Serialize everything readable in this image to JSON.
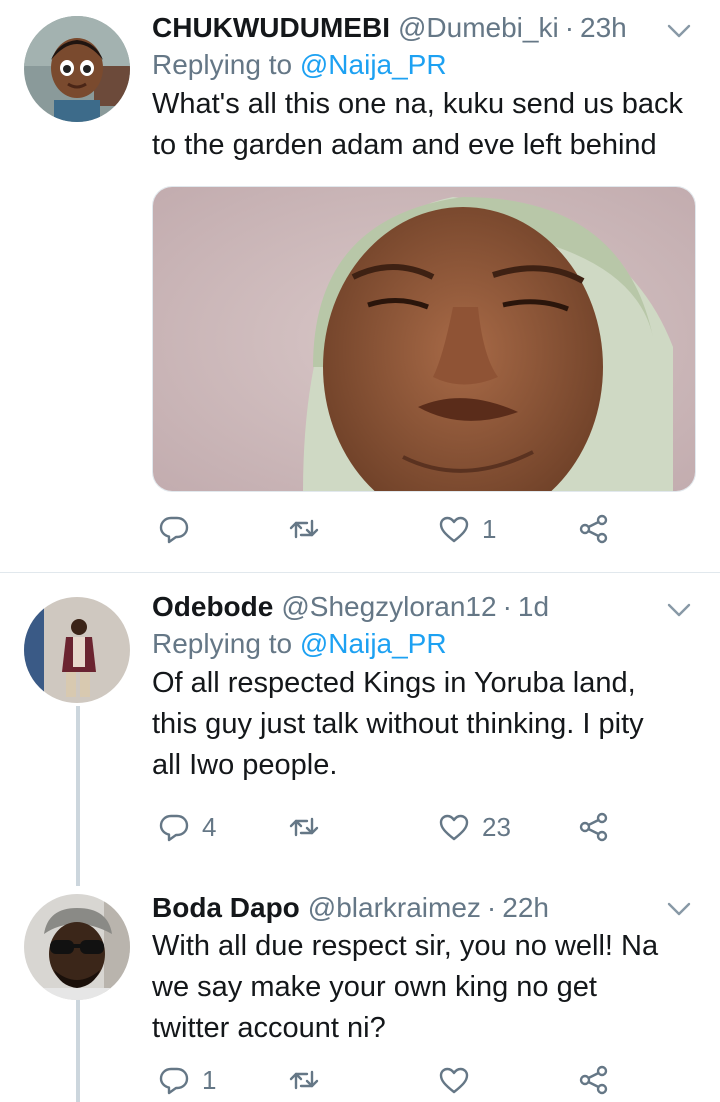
{
  "tweets": [
    {
      "name": "CHUKWUDUMEBI",
      "handle": "@Dumebi_ki",
      "time": "23h",
      "replying_prefix": "Replying to",
      "replying_to": "@Naija_PR",
      "text_lines": [
        "What's all this one na, kuku send us back",
        "to the garden adam and eve left behind"
      ],
      "has_media": true,
      "replies": "",
      "retweets": "",
      "likes": "1"
    },
    {
      "name": "Odebode",
      "handle": "@Shegzyloran12",
      "time": "1d",
      "replying_prefix": "Replying to",
      "replying_to": "@Naija_PR",
      "text_lines": [
        "Of all respected Kings in Yoruba land,",
        "this guy just talk without thinking. I pity",
        "all Iwo people."
      ],
      "replies": "4",
      "retweets": "",
      "likes": "23"
    },
    {
      "name": "Boda Dapo",
      "handle": "@blarkraimez",
      "time": "22h",
      "text_lines": [
        "With all due respect sir, you no well! Na",
        "we say make your own king no get",
        "twitter account ni?"
      ],
      "replies": "1",
      "retweets": "",
      "likes": ""
    }
  ],
  "separator": "·",
  "colors": {
    "muted": "#657786",
    "link": "#1da1f2",
    "text": "#14171a",
    "thread": "#ccd6dd"
  },
  "icons": [
    "reply-icon",
    "retweet-icon",
    "like-icon",
    "share-icon",
    "chevron-down-icon"
  ]
}
